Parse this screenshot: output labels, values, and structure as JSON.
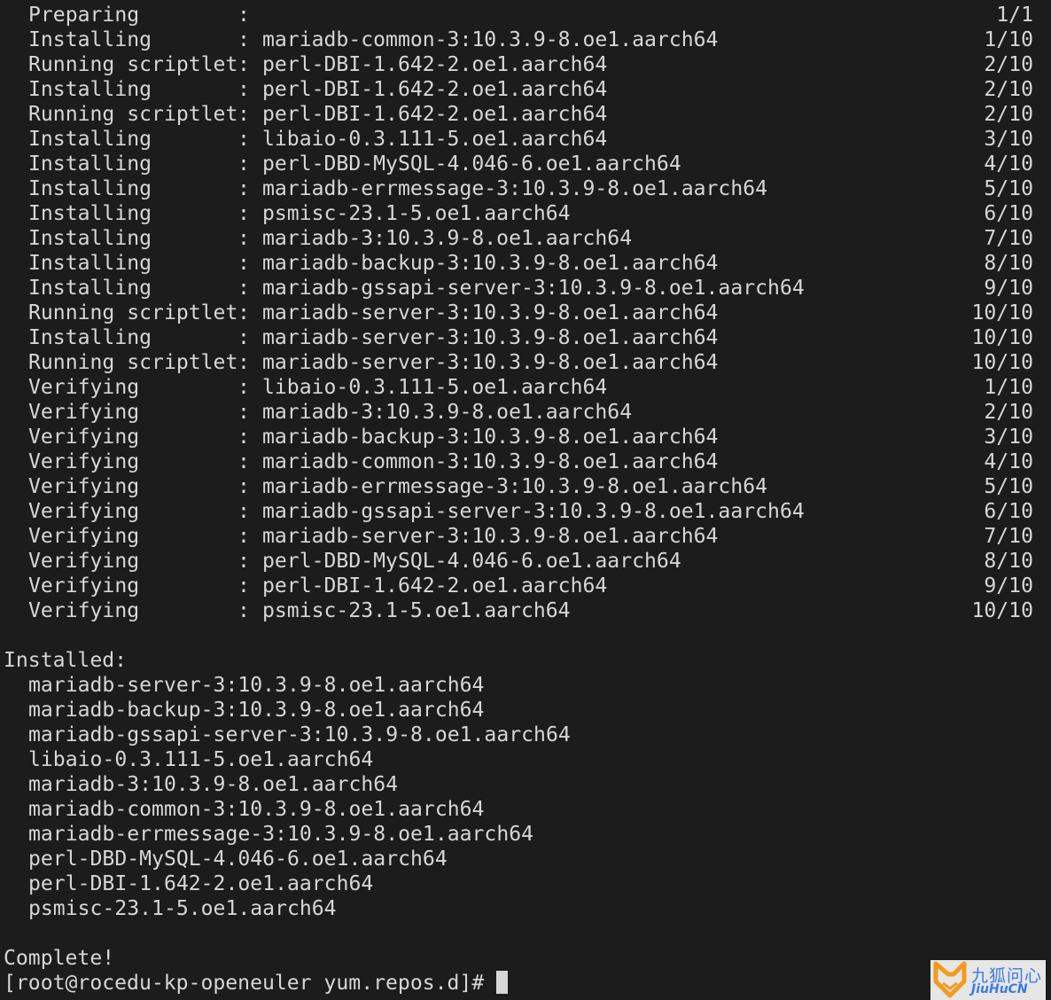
{
  "transaction_rows": [
    {
      "action": "Preparing",
      "package": "",
      "count": "1/1"
    },
    {
      "action": "Installing",
      "package": "mariadb-common-3:10.3.9-8.oe1.aarch64",
      "count": "1/10"
    },
    {
      "action": "Running scriptlet",
      "package": "perl-DBI-1.642-2.oe1.aarch64",
      "count": "2/10"
    },
    {
      "action": "Installing",
      "package": "perl-DBI-1.642-2.oe1.aarch64",
      "count": "2/10"
    },
    {
      "action": "Running scriptlet",
      "package": "perl-DBI-1.642-2.oe1.aarch64",
      "count": "2/10"
    },
    {
      "action": "Installing",
      "package": "libaio-0.3.111-5.oe1.aarch64",
      "count": "3/10"
    },
    {
      "action": "Installing",
      "package": "perl-DBD-MySQL-4.046-6.oe1.aarch64",
      "count": "4/10"
    },
    {
      "action": "Installing",
      "package": "mariadb-errmessage-3:10.3.9-8.oe1.aarch64",
      "count": "5/10"
    },
    {
      "action": "Installing",
      "package": "psmisc-23.1-5.oe1.aarch64",
      "count": "6/10"
    },
    {
      "action": "Installing",
      "package": "mariadb-3:10.3.9-8.oe1.aarch64",
      "count": "7/10"
    },
    {
      "action": "Installing",
      "package": "mariadb-backup-3:10.3.9-8.oe1.aarch64",
      "count": "8/10"
    },
    {
      "action": "Installing",
      "package": "mariadb-gssapi-server-3:10.3.9-8.oe1.aarch64",
      "count": "9/10"
    },
    {
      "action": "Running scriptlet",
      "package": "mariadb-server-3:10.3.9-8.oe1.aarch64",
      "count": "10/10"
    },
    {
      "action": "Installing",
      "package": "mariadb-server-3:10.3.9-8.oe1.aarch64",
      "count": "10/10"
    },
    {
      "action": "Running scriptlet",
      "package": "mariadb-server-3:10.3.9-8.oe1.aarch64",
      "count": "10/10"
    },
    {
      "action": "Verifying",
      "package": "libaio-0.3.111-5.oe1.aarch64",
      "count": "1/10"
    },
    {
      "action": "Verifying",
      "package": "mariadb-3:10.3.9-8.oe1.aarch64",
      "count": "2/10"
    },
    {
      "action": "Verifying",
      "package": "mariadb-backup-3:10.3.9-8.oe1.aarch64",
      "count": "3/10"
    },
    {
      "action": "Verifying",
      "package": "mariadb-common-3:10.3.9-8.oe1.aarch64",
      "count": "4/10"
    },
    {
      "action": "Verifying",
      "package": "mariadb-errmessage-3:10.3.9-8.oe1.aarch64",
      "count": "5/10"
    },
    {
      "action": "Verifying",
      "package": "mariadb-gssapi-server-3:10.3.9-8.oe1.aarch64",
      "count": "6/10"
    },
    {
      "action": "Verifying",
      "package": "mariadb-server-3:10.3.9-8.oe1.aarch64",
      "count": "7/10"
    },
    {
      "action": "Verifying",
      "package": "perl-DBD-MySQL-4.046-6.oe1.aarch64",
      "count": "8/10"
    },
    {
      "action": "Verifying",
      "package": "perl-DBI-1.642-2.oe1.aarch64",
      "count": "9/10"
    },
    {
      "action": "Verifying",
      "package": "psmisc-23.1-5.oe1.aarch64",
      "count": "10/10"
    }
  ],
  "installed_header": "Installed:",
  "installed_packages": [
    "mariadb-server-3:10.3.9-8.oe1.aarch64",
    "mariadb-backup-3:10.3.9-8.oe1.aarch64",
    "mariadb-gssapi-server-3:10.3.9-8.oe1.aarch64",
    "libaio-0.3.111-5.oe1.aarch64",
    "mariadb-3:10.3.9-8.oe1.aarch64",
    "mariadb-common-3:10.3.9-8.oe1.aarch64",
    "mariadb-errmessage-3:10.3.9-8.oe1.aarch64",
    "perl-DBD-MySQL-4.046-6.oe1.aarch64",
    "perl-DBI-1.642-2.oe1.aarch64",
    "psmisc-23.1-5.oe1.aarch64"
  ],
  "complete_text": "Complete!",
  "prompt": "[root@rocedu-kp-openeuler yum.repos.d]# ",
  "watermark": {
    "chinese": "九狐问心",
    "latin": "JiuHuCN",
    "logo": "fox-logo",
    "accent": "#f29b1d",
    "text_color": "#3a7be0"
  },
  "colors": {
    "background": "#1c1c1c",
    "foreground": "#d6d6d6"
  }
}
